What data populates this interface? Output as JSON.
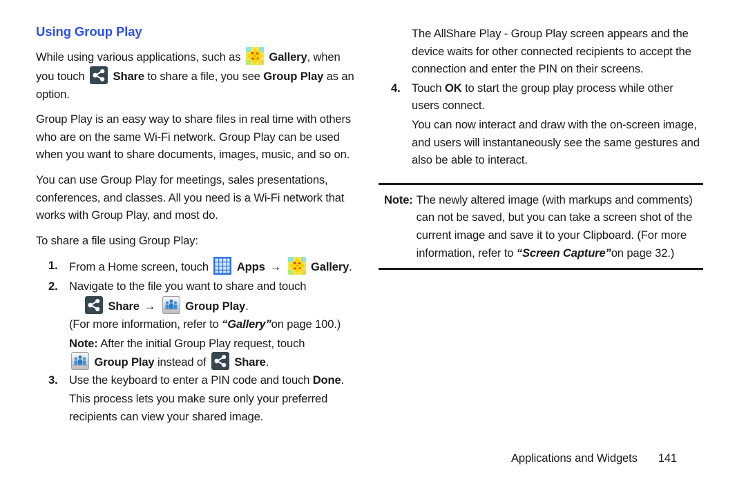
{
  "page": {
    "footer_section": "Applications and Widgets",
    "footer_page_number": "141",
    "heading_color": "#2b4fe8"
  },
  "left_column": {
    "heading": "Using Group Play",
    "p1_a": "While using various applications, such as",
    "p1_gallery": "Gallery",
    "p1_b": ", when you touch",
    "p1_share": "Share",
    "p1_c": "to share a file, you see",
    "p1_groupplay": "Group Play",
    "p1_d": "as an option.",
    "p2": "Group Play is an easy way to share files in real time with others who are on the same Wi-Fi network. Group Play can be used when you want to share documents, images, music, and so on.",
    "p3": "You can use Group Play for meetings, sales presentations, conferences, and classes. All you need is a Wi-Fi network that works with Group Play, and most do.",
    "p4": "To share a file using Group Play:",
    "step1": {
      "num": "1.",
      "text_a": "From a Home screen, touch",
      "apps_label": "Apps",
      "arrow": "→",
      "gallery_label": "Gallery",
      "text_b": "."
    },
    "step2": {
      "num": "2.",
      "text_a": "Navigate to the file you want to share and touch",
      "share_label": "Share",
      "arrow": "→",
      "groupplay_label": "Group Play",
      "period": ".",
      "ref_a": "(For more information, refer to",
      "ref_title": "“Gallery”",
      "ref_b": "on page 100.)",
      "note_label": "Note:",
      "note_a": "After the initial Group Play request, touch",
      "note_groupplay": "Group Play",
      "note_b": "instead of",
      "note_share": "Share",
      "note_c": "."
    },
    "step3": {
      "num": "3.",
      "text_a": "Use the keyboard to enter a PIN code and touch",
      "done_label": "Done",
      "text_b": ".",
      "sub": "This process lets you make sure only your preferred recipients can view your shared image."
    }
  },
  "right_column": {
    "p1": "The AllShare Play - Group Play screen appears and the device waits for other connected recipients to accept the connection and enter the PIN on their screens.",
    "step4": {
      "num": "4.",
      "text_a": "Touch",
      "ok_label": "OK",
      "text_b": "to start the group play process while other users connect.",
      "sub": "You can now interact and draw with the on-screen image, and users will instantaneously see the same gestures and also be able to interact."
    },
    "note": {
      "label": "Note:",
      "text_a": "The newly altered image (with markups and comments) can not be saved, but you can take a screen shot of the current image and save it to your Clipboard. (For more information, refer to",
      "ref_title": "“Screen Capture”",
      "text_b": "on page 32.)"
    }
  },
  "icons": {
    "gallery": "gallery-icon",
    "share": "share-icon",
    "apps": "apps-grid-icon",
    "group_play": "group-play-icon"
  }
}
